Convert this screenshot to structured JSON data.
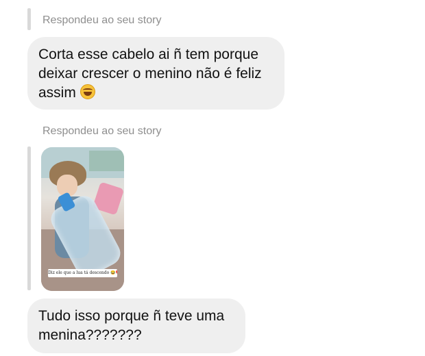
{
  "messages": [
    {
      "reply_label": "Respondeu ao seu story",
      "text": "Corta esse cabelo ai ñ tem porque deixar crescer o menino não é feliz assim",
      "emoji": "laughing-crying-emoji"
    },
    {
      "reply_label": "Respondeu ao seu story",
      "story_caption": "Diz ele que a lua tá descendo",
      "story_caption_emoji": "😂❤️"
    },
    {
      "text": "Tudo isso porque ñ teve uma menina???????"
    }
  ],
  "colors": {
    "bubble": "#efefef",
    "label": "#8e8e8e",
    "reply_bar": "#d9d9d9",
    "background": "#ffffff"
  }
}
